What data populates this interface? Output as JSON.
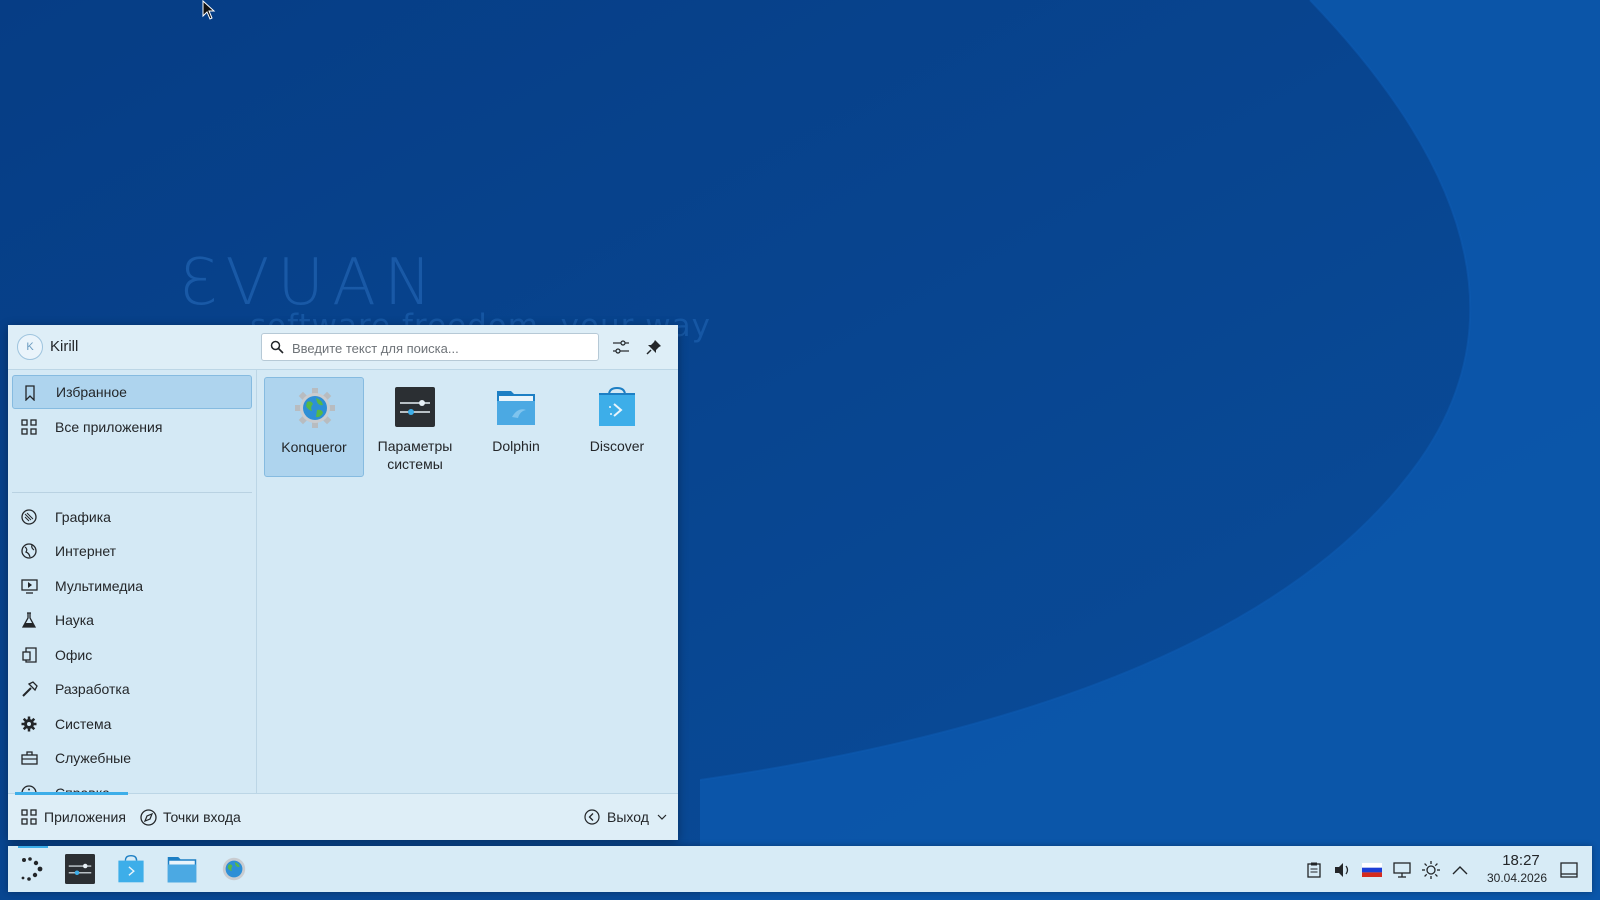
{
  "wallpaper": {
    "brand": "ƐVUAN",
    "tagline": "software freedom, your way"
  },
  "launcher": {
    "user": {
      "initial": "K",
      "name": "Kirill"
    },
    "search": {
      "placeholder": "Введите текст для поиска..."
    },
    "sidebar": {
      "items": [
        {
          "label": "Избранное",
          "icon": "bookmark-icon",
          "selected": true
        },
        {
          "label": "Все приложения",
          "icon": "grid-icon"
        },
        {
          "label": "Графика",
          "icon": "graphics-icon"
        },
        {
          "label": "Интернет",
          "icon": "globe-icon"
        },
        {
          "label": "Мультимедиа",
          "icon": "multimedia-icon"
        },
        {
          "label": "Наука",
          "icon": "flask-icon"
        },
        {
          "label": "Офис",
          "icon": "office-icon"
        },
        {
          "label": "Разработка",
          "icon": "hammer-icon"
        },
        {
          "label": "Система",
          "icon": "gear-icon"
        },
        {
          "label": "Служебные",
          "icon": "toolbox-icon"
        },
        {
          "label": "Справка",
          "icon": "info-icon"
        }
      ]
    },
    "favorites": [
      {
        "label": "Konqueror",
        "icon": "konqueror-icon",
        "selected": true
      },
      {
        "label": "Параметры системы",
        "icon": "system-settings-icon"
      },
      {
        "label": "Dolphin",
        "icon": "dolphin-folder-icon"
      },
      {
        "label": "Discover",
        "icon": "discover-bag-icon"
      }
    ],
    "footer": {
      "apps_label": "Приложения",
      "places_label": "Точки входа",
      "leave_label": "Выход"
    }
  },
  "taskbar": {
    "clock": {
      "time": "18:27",
      "date": "30.04.2026"
    },
    "tray": [
      "clipboard-icon",
      "volume-icon",
      "keyboard-layout-flag-ru",
      "network-icon",
      "brightness-icon",
      "expand-tray-icon"
    ]
  },
  "colors": {
    "accent": "#3daee9",
    "selection": "#aed4ee",
    "wallpaper_dark": "#073c80",
    "wallpaper_light": "#0d55a8"
  }
}
